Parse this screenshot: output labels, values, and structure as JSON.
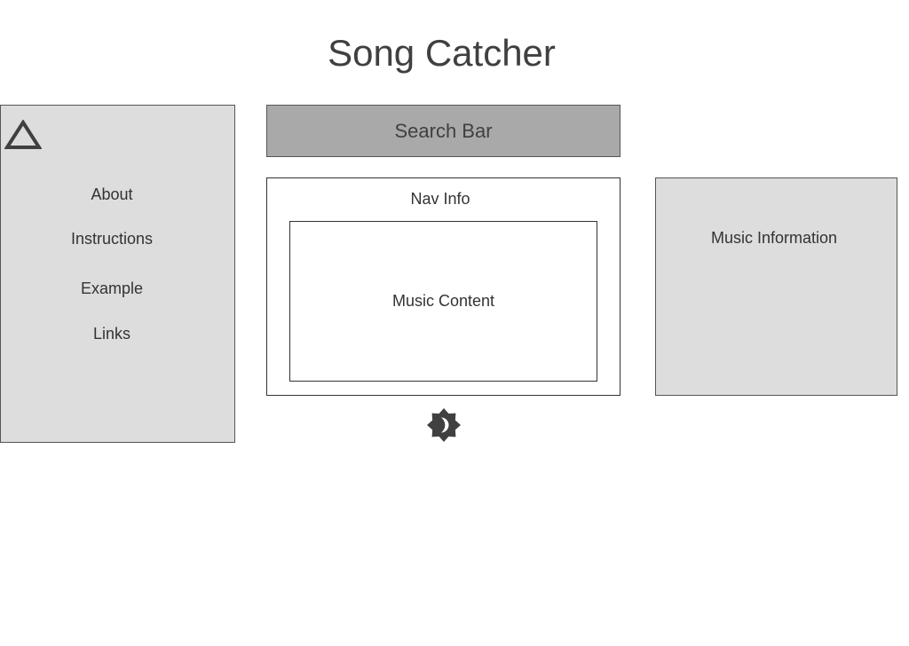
{
  "header": {
    "title": "Song Catcher"
  },
  "sidebar": {
    "logo_icon": "triangle-logo-icon",
    "items": [
      {
        "label": "About"
      },
      {
        "label": "Instructions"
      },
      {
        "label": "Example"
      },
      {
        "label": "Links"
      }
    ]
  },
  "search": {
    "label": "Search Bar"
  },
  "nav_info": {
    "label": "Nav Info",
    "music_content_label": "Music Content"
  },
  "music_info": {
    "label": "Music Information"
  },
  "theme_toggle": {
    "icon": "brightness-icon"
  },
  "colors": {
    "panel_gray": "#dddddd",
    "search_gray": "#a9a9a9",
    "text_dark": "#333333",
    "border": "#555555"
  }
}
